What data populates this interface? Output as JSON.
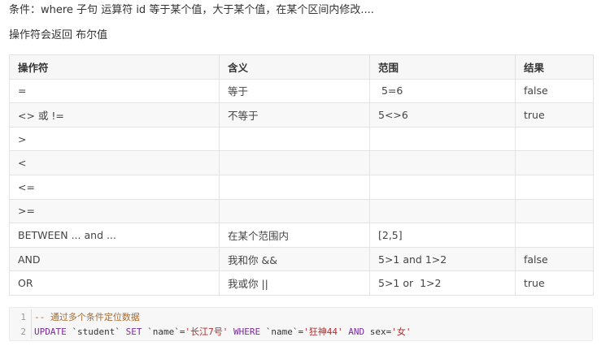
{
  "intro": {
    "line1": "条件：where 子句 运算符  id 等于某个值，大于某个值，在某个区间内修改....",
    "line2": "操作符会返回 布尔值"
  },
  "table": {
    "headers": [
      "操作符",
      "含义",
      "范围",
      "结果"
    ],
    "rows": [
      [
        "=",
        "等于",
        " 5=6",
        "false"
      ],
      [
        "<> 或 !=",
        "不等于",
        "5<>6",
        "true"
      ],
      [
        ">",
        "",
        "",
        ""
      ],
      [
        "<",
        "",
        "",
        ""
      ],
      [
        "<=",
        "",
        "",
        ""
      ],
      [
        ">=",
        "",
        "",
        ""
      ],
      [
        "BETWEEN ... and ...",
        "在某个范围内",
        "[2,5]",
        ""
      ],
      [
        "AND",
        "我和你 &&",
        "5>1 and 1>2",
        "false"
      ],
      [
        "OR",
        "我或你 ||",
        "5>1 or  1>2",
        "true"
      ]
    ]
  },
  "code": {
    "line_numbers": [
      "1",
      "2"
    ],
    "comment": "-- 通过多个条件定位数据",
    "tokens": {
      "update": "UPDATE",
      "table": " `student` ",
      "set": "SET",
      "col1": " `name`=",
      "val1": "'长江7号'",
      "space1": " ",
      "where": "WHERE",
      "col2": " `name`=",
      "val2": "'狂神44'",
      "space2": " ",
      "and": "AND",
      "col3": " sex=",
      "val3": "'女'"
    }
  }
}
